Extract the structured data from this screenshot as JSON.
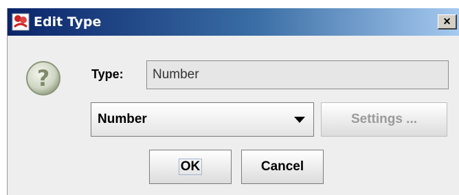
{
  "window": {
    "title": "Edit Type"
  },
  "icons": {
    "app": "duke-app-icon",
    "question": "question-icon",
    "close": "close-icon",
    "dropdown": "chevron-down-icon"
  },
  "titlebar": {
    "close_glyph": "×"
  },
  "form": {
    "type_label": "Type:",
    "type_value": "Number",
    "combo_selected": "Number",
    "settings_label": "Settings ..."
  },
  "buttons": {
    "ok": "OK",
    "cancel": "Cancel"
  },
  "colors": {
    "titlebar_start": "#0a246a",
    "titlebar_end": "#a6caf0",
    "dialog_bg": "#eeeeee",
    "disabled_text": "#9a9a9a"
  }
}
